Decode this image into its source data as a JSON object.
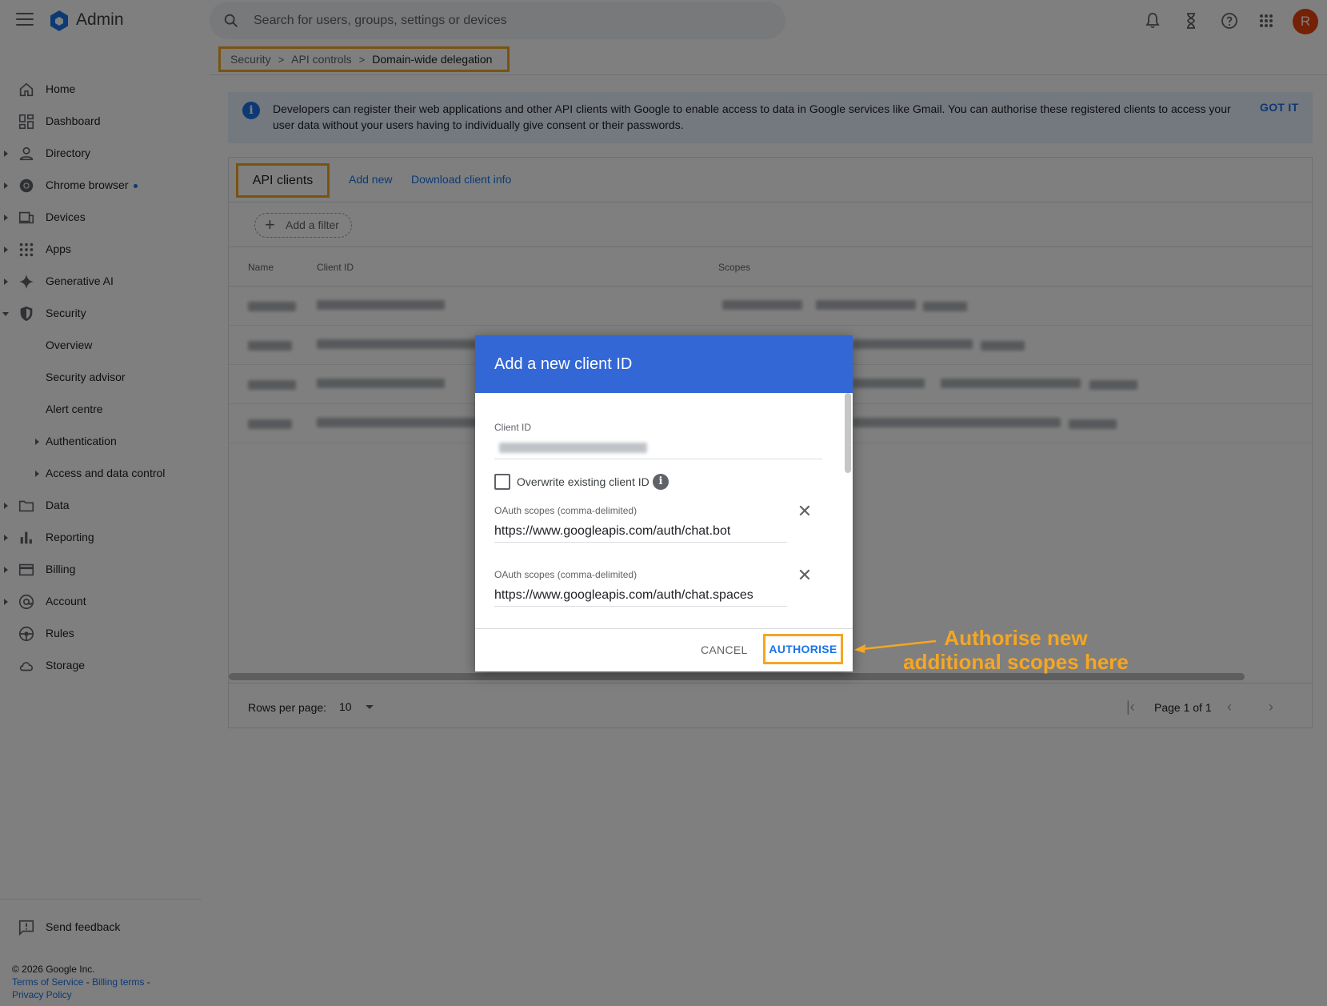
{
  "app": {
    "title": "Admin"
  },
  "search": {
    "placeholder": "Search for users, groups, settings or devices"
  },
  "user": {
    "avatar_initial": "R"
  },
  "sidebar": {
    "items": [
      {
        "label": "Home"
      },
      {
        "label": "Dashboard"
      },
      {
        "label": "Directory"
      },
      {
        "label": "Chrome browser"
      },
      {
        "label": "Devices"
      },
      {
        "label": "Apps"
      },
      {
        "label": "Generative AI"
      },
      {
        "label": "Security"
      },
      {
        "label": "Overview"
      },
      {
        "label": "Security advisor"
      },
      {
        "label": "Alert centre"
      },
      {
        "label": "Authentication"
      },
      {
        "label": "Access and data control"
      },
      {
        "label": "Data"
      },
      {
        "label": "Reporting"
      },
      {
        "label": "Billing"
      },
      {
        "label": "Account"
      },
      {
        "label": "Rules"
      },
      {
        "label": "Storage"
      }
    ],
    "feedback": "Send feedback"
  },
  "footer": {
    "copyright": "© 2026 Google Inc.",
    "terms": "Terms of Service",
    "billing_terms": "Billing terms",
    "privacy": "Privacy Policy"
  },
  "breadcrumb": {
    "items": [
      "Security",
      "API controls",
      "Domain-wide delegation"
    ]
  },
  "banner": {
    "text": "Developers can register their web applications and other API clients with Google to enable access to data in Google services like Gmail. You can authorise these registered clients to access your user data without your users having to individually give consent or their passwords.",
    "action": "GOT IT"
  },
  "tabs": {
    "active": "API clients",
    "add_new": "Add new",
    "download": "Download client info"
  },
  "filter": {
    "label": "Add a filter"
  },
  "table": {
    "headers": {
      "name": "Name",
      "client_id": "Client ID",
      "scopes": "Scopes"
    }
  },
  "pager": {
    "rows_label": "Rows per page:",
    "rows_value": "10",
    "page_label": "Page 1 of 1"
  },
  "dialog": {
    "title": "Add a new client ID",
    "client_id_label": "Client ID",
    "overwrite_label": "Overwrite existing client ID",
    "scope_label": "OAuth scopes (comma-delimited)",
    "scope1_value": "https://www.googleapis.com/auth/chat.bot",
    "scope2_value": "https://www.googleapis.com/auth/chat.spaces",
    "cancel": "CANCEL",
    "authorise": "AUTHORISE"
  },
  "annotation": {
    "line1": "Authorise new",
    "line2": "additional scopes here"
  },
  "colors": {
    "accent": "#1a73e8",
    "header": "#3367d6",
    "highlight": "#f5a623"
  }
}
